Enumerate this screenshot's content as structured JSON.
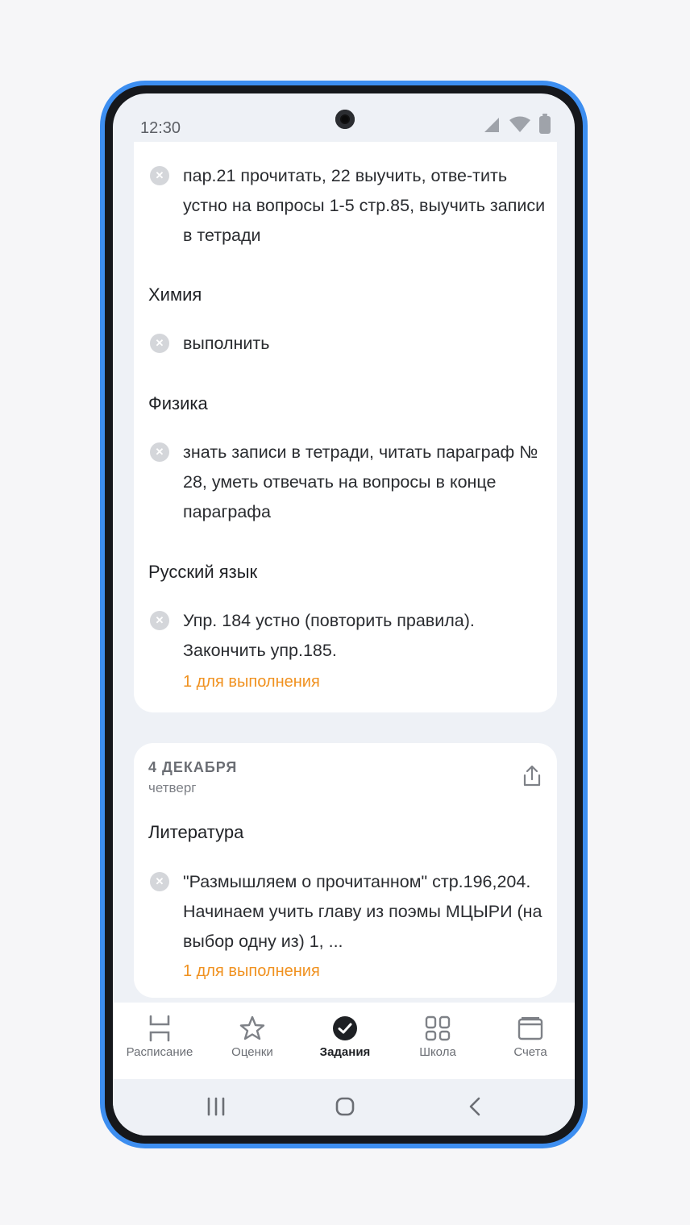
{
  "status": {
    "time": "12:30"
  },
  "card1": {
    "tasks": [
      {
        "text": "пар.21 прочитать, 22 выучить, отве-тить устно на вопросы  1-5 стр.85, выучить записи в тетради"
      }
    ],
    "subjects": [
      {
        "name": "Химия",
        "task": "выполнить"
      },
      {
        "name": "Физика",
        "task": "знать записи в тетради, читать параграф № 28, уметь отвечать на вопросы в конце параграфа"
      },
      {
        "name": "Русский язык",
        "task": "Упр. 184 устно (повторить правила). Закончить упр.185.",
        "extra": "1 для выполнения"
      }
    ]
  },
  "card2": {
    "date": "4 ДЕКАБРЯ",
    "weekday": "четверг",
    "subject": "Литература",
    "task": "\"Размышляем о прочитанном\" стр.196,204. Начинаем учить главу из поэмы МЦЫРИ (на выбор одну из) 1, ...",
    "extra": "1 для выполнения"
  },
  "tabs": [
    {
      "label": "Расписание",
      "icon": "schedule-icon"
    },
    {
      "label": "Оценки",
      "icon": "star-icon"
    },
    {
      "label": "Задания",
      "icon": "check-circle-icon",
      "active": true
    },
    {
      "label": "Школа",
      "icon": "grid-icon"
    },
    {
      "label": "Счета",
      "icon": "wallet-icon"
    }
  ],
  "colors": {
    "accent_orange": "#f0911f",
    "frame_blue": "#3d8ef0"
  }
}
